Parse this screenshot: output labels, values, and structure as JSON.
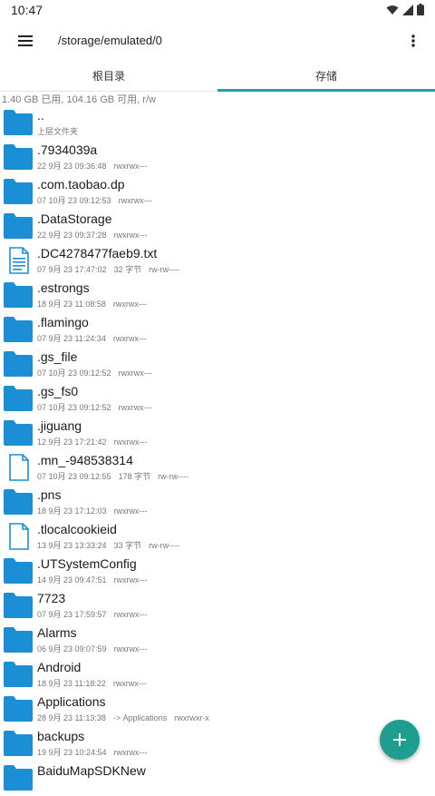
{
  "status": {
    "time": "10:47"
  },
  "toolbar": {
    "path": "/storage/emulated/0"
  },
  "tabs": [
    {
      "label": "根目录"
    },
    {
      "label": "存储"
    }
  ],
  "storage_info": "1.40 GB 已用, 104.16 GB 可用, r/w",
  "files": [
    {
      "name": "..",
      "date": "上层文件夹",
      "size": "",
      "perm": "",
      "type": "folder"
    },
    {
      "name": ".7934039a",
      "date": "22 9月 23 09:36:48",
      "size": "",
      "perm": "rwxrwx---",
      "type": "folder"
    },
    {
      "name": ".com.taobao.dp",
      "date": "07 10月 23 09:12:53",
      "size": "",
      "perm": "rwxrwx---",
      "type": "folder"
    },
    {
      "name": ".DataStorage",
      "date": "22 9月 23 09:37:28",
      "size": "",
      "perm": "rwxrwx---",
      "type": "folder"
    },
    {
      "name": ".DC4278477faeb9.txt",
      "date": "07 9月 23 17:47:02",
      "size": "32 字节",
      "perm": "rw-rw----",
      "type": "text"
    },
    {
      "name": ".estrongs",
      "date": "18 9月 23 11:08:58",
      "size": "",
      "perm": "rwxrwx---",
      "type": "folder"
    },
    {
      "name": ".flamingo",
      "date": "07 9月 23 11:24:34",
      "size": "",
      "perm": "rwxrwx---",
      "type": "folder"
    },
    {
      "name": ".gs_file",
      "date": "07 10月 23 09:12:52",
      "size": "",
      "perm": "rwxrwx---",
      "type": "folder"
    },
    {
      "name": ".gs_fs0",
      "date": "07 10月 23 09:12:52",
      "size": "",
      "perm": "rwxrwx---",
      "type": "folder"
    },
    {
      "name": ".jiguang",
      "date": "12 9月 23 17:21:42",
      "size": "",
      "perm": "rwxrwx---",
      "type": "folder"
    },
    {
      "name": ".mn_-948538314",
      "date": "07 10月 23 09:12:55",
      "size": "178 字节",
      "perm": "rw-rw----",
      "type": "file"
    },
    {
      "name": ".pns",
      "date": "18 9月 23 17:12:03",
      "size": "",
      "perm": "rwxrwx---",
      "type": "folder"
    },
    {
      "name": ".tlocalcookieid",
      "date": "13 9月 23 13:33:24",
      "size": "33 字节",
      "perm": "rw-rw----",
      "type": "file"
    },
    {
      "name": ".UTSystemConfig",
      "date": "14 9月 23 09:47:51",
      "size": "",
      "perm": "rwxrwx---",
      "type": "folder"
    },
    {
      "name": "7723",
      "date": "07 9月 23 17:59:57",
      "size": "",
      "perm": "rwxrwx---",
      "type": "folder"
    },
    {
      "name": "Alarms",
      "date": "06 9月 23 09:07:59",
      "size": "",
      "perm": "rwxrwx---",
      "type": "folder"
    },
    {
      "name": "Android",
      "date": "18 9月 23 11:18:22",
      "size": "",
      "perm": "rwxrwx---",
      "type": "folder"
    },
    {
      "name": "Applications",
      "date": "28 9月 23 11:13:38",
      "size": "-> Applications",
      "perm": "rwxrwxr-x",
      "type": "folder"
    },
    {
      "name": "backups",
      "date": "19 9月 23 10:24:54",
      "size": "",
      "perm": "rwxrwx---",
      "type": "folder"
    },
    {
      "name": "BaiduMapSDKNew",
      "date": "",
      "size": "",
      "perm": "",
      "type": "folder"
    }
  ],
  "colors": {
    "accent": "#1e9fb0",
    "folder": "#1a8fd6",
    "fab": "#1f9e8f"
  },
  "icons": {
    "menu": "hamburger-icon",
    "more": "more-vert-icon",
    "fab": "plus-icon"
  }
}
